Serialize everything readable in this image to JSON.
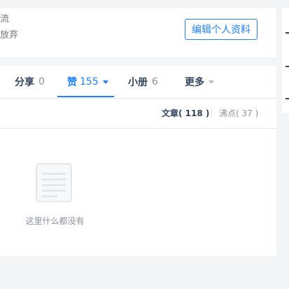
{
  "profile": {
    "line1": "流",
    "line2": "放弃",
    "edit_label": "编辑个人资料"
  },
  "tabs": [
    {
      "label": "分享",
      "count": "0"
    },
    {
      "label": "赞",
      "count": "155"
    },
    {
      "label": "小册",
      "count": "6"
    },
    {
      "label": "更多",
      "count": ""
    }
  ],
  "filters": [
    {
      "label": "文章",
      "count": "118"
    },
    {
      "label": "沸点",
      "count": "37"
    }
  ],
  "filter_texts": [
    "文章( 118 )",
    "沸点( 37 )"
  ],
  "empty": {
    "message": "这里什么都没有"
  },
  "colors": {
    "accent": "#1e80ff",
    "text": "#31445b",
    "muted": "#8a919f",
    "border": "#e4e6eb"
  },
  "icons": {
    "active_tab_caret": "caret-down-icon",
    "more_caret": "caret-down-icon",
    "empty": "document-icon"
  }
}
